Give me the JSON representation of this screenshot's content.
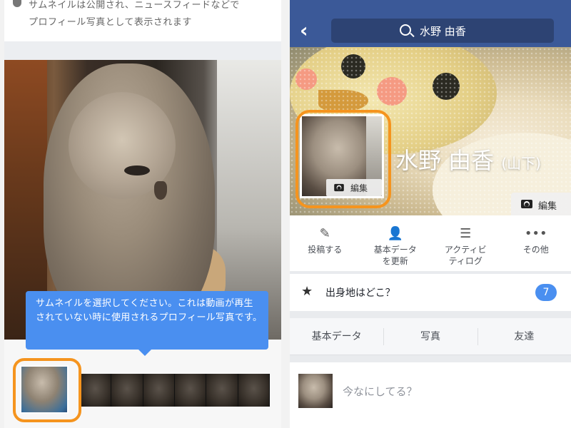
{
  "left": {
    "top_text_line1": "サムネイルは公開され、ニュースフィードなどで",
    "top_text_line2": "プロフィール写真として表示されます",
    "tooltip": "サムネイルを選択してください。これは動画が再生されていない時に使用されるプロフィール写真です。",
    "filmstrip_frames": 6
  },
  "right": {
    "search_text": "水野 由香",
    "profile_name": "水野 由香",
    "maiden_name": "(山下)",
    "cover_edit_label": "編集",
    "profile_edit_label": "編集",
    "actions": [
      {
        "icon": "edit-icon",
        "label": "投稿する"
      },
      {
        "icon": "person-edit-icon",
        "label": "基本データ\nを更新"
      },
      {
        "icon": "activity-list-icon",
        "label": "アクティビ\nティログ"
      },
      {
        "icon": "more-icon",
        "label": "その他"
      }
    ],
    "hometown_prompt": "出身地はどこ？",
    "hometown_badge": "7",
    "tabs": [
      "基本データ",
      "写真",
      "友達"
    ],
    "composer_placeholder": "今なにしてる？"
  },
  "colors": {
    "facebook_blue": "#3b5998",
    "highlight_orange": "#f5941e",
    "tooltip_blue": "#4a8ff0"
  }
}
